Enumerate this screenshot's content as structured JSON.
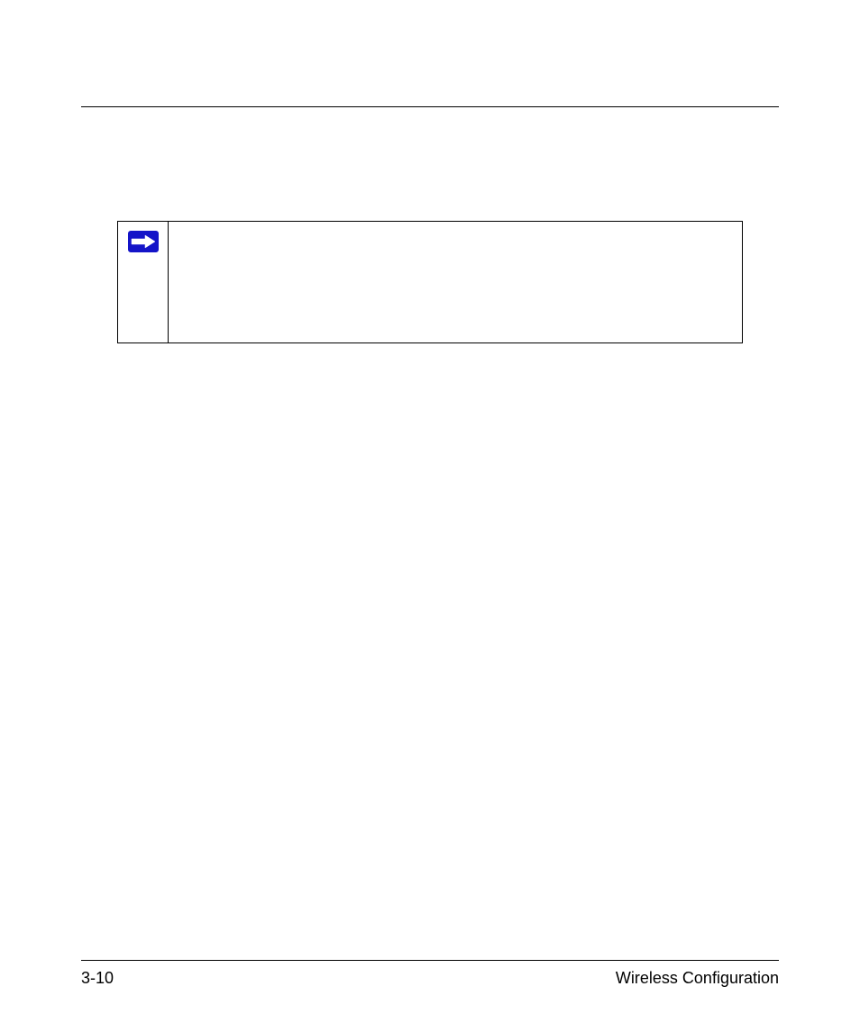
{
  "footer": {
    "page_number": "3-10",
    "section_title": "Wireless Configuration"
  },
  "note": {
    "icon": "arrow-right-icon",
    "body": ""
  }
}
